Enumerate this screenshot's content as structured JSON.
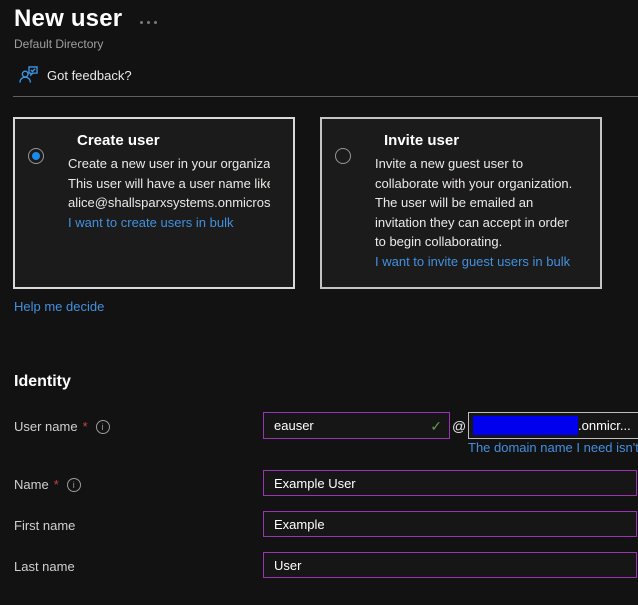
{
  "header": {
    "title": "New user",
    "subtitle": "Default Directory",
    "feedback_label": "Got feedback?"
  },
  "cards": [
    {
      "title": "Create user",
      "selected": true,
      "lines": [
        "Create a new user in your organization.",
        "This user will have a user name like",
        "alice@shallsparxsystems.onmicrosoft.com."
      ],
      "link": "I want to create users in bulk"
    },
    {
      "title": "Invite user",
      "selected": false,
      "lines": [
        "Invite a new guest user to",
        "collaborate with your organization.",
        "The user will be emailed an",
        "invitation they can accept in order",
        "to begin collaborating."
      ],
      "link": "I want to invite guest users in bulk"
    }
  ],
  "help_link": "Help me decide",
  "identity": {
    "heading": "Identity",
    "user_name": {
      "label": "User name",
      "required_marker": "*",
      "value": "eauser",
      "at": "@",
      "domain_suffix": ".onmicr...",
      "domain_link": "The domain name I need isn't"
    },
    "name": {
      "label": "Name",
      "required_marker": "*",
      "value": "Example User"
    },
    "first_name": {
      "label": "First name",
      "value": "Example"
    },
    "last_name": {
      "label": "Last name",
      "value": "User"
    }
  },
  "icons": {
    "info_glyph": "i",
    "check_glyph": "✓"
  },
  "colors": {
    "background": "#121212",
    "card_background": "#1b1b1b",
    "link_blue": "#4390df",
    "radio_blue": "#1e8ae8",
    "dirty_field_purple": "#9a34b4",
    "selection_blue": "#0000ee",
    "valid_green": "#5f9e49",
    "required_red": "#c94343"
  }
}
